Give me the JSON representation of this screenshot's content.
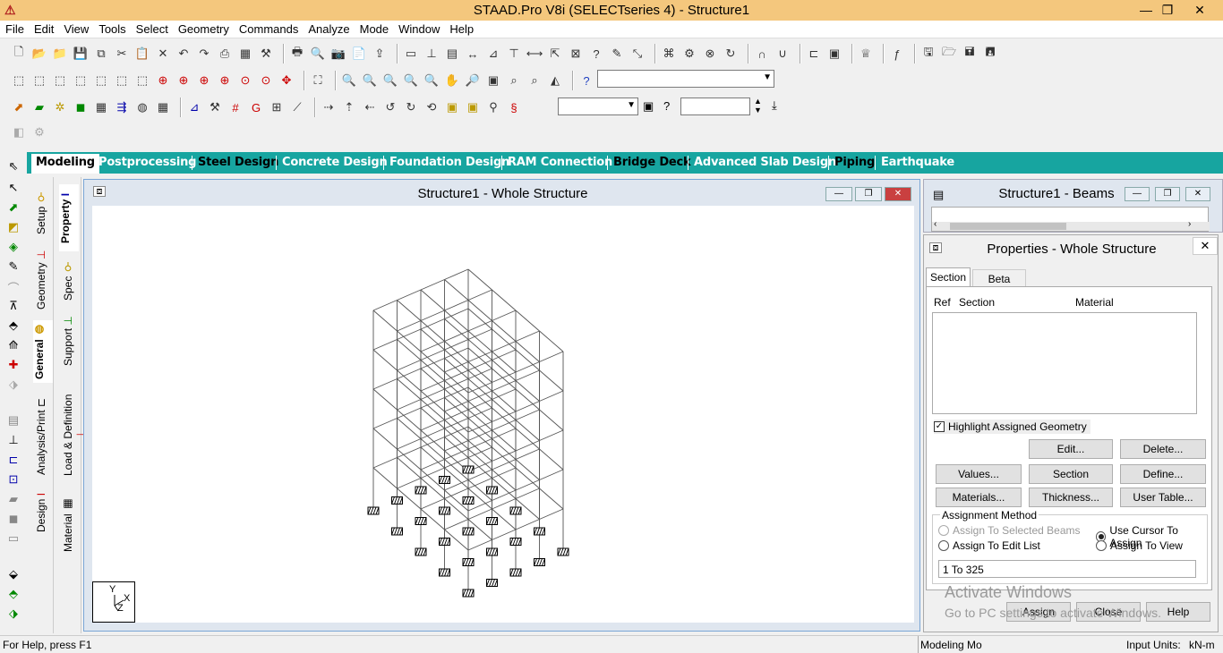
{
  "app": {
    "title": "STAAD.Pro V8i (SELECTseries 4) - Structure1",
    "icon_glyph": "⚠",
    "minimize": "—",
    "restore": "❐",
    "close": "✕"
  },
  "menus": [
    "File",
    "Edit",
    "View",
    "Tools",
    "Select",
    "Geometry",
    "Commands",
    "Analyze",
    "Mode",
    "Window",
    "Help"
  ],
  "toolbar2": {
    "combo_value": ""
  },
  "toolbar3": {
    "combo_value": "",
    "input_value": ""
  },
  "tabs": [
    {
      "label": "Modeling",
      "style": "active"
    },
    {
      "label": "Postprocessing",
      "style": "light"
    },
    {
      "label": "Steel Design",
      "style": "dark"
    },
    {
      "label": "Concrete Design",
      "style": "light"
    },
    {
      "label": "Foundation Design",
      "style": "light"
    },
    {
      "label": "RAM Connection",
      "style": "light"
    },
    {
      "label": "Bridge Deck",
      "style": "dark"
    },
    {
      "label": "Advanced Slab Design",
      "style": "light"
    },
    {
      "label": "Piping",
      "style": "dark"
    },
    {
      "label": "Earthquake",
      "style": "light"
    }
  ],
  "page_control_outer": [
    "Setup",
    "Geometry",
    "General",
    "Analysis/Print",
    "Design"
  ],
  "page_control_inner": [
    "Property",
    "Spec",
    "Support",
    "Load & Definition",
    "Material"
  ],
  "structure_window": {
    "title": "Structure1 - Whole Structure"
  },
  "axis": {
    "y": "Y",
    "x": "X",
    "z": "Z"
  },
  "beams_window": {
    "title": "Structure1 - Beams"
  },
  "properties": {
    "title": "Properties - Whole Structure",
    "tabs": [
      "Section",
      "Beta Angle"
    ],
    "columns": {
      "ref": "Ref",
      "section": "Section",
      "material": "Material"
    },
    "highlight_label": "Highlight Assigned Geometry",
    "buttons": {
      "edit": "Edit...",
      "delete": "Delete...",
      "values": "Values...",
      "section_db": "Section Database",
      "define": "Define...",
      "materials": "Materials...",
      "thickness": "Thickness...",
      "user_table": "User Table..."
    },
    "assignment": {
      "legend": "Assignment Method",
      "selected_beams": "Assign To Selected Beams",
      "cursor": "Use Cursor To Assign",
      "edit_list": "Assign To Edit List",
      "view": "Assign To View",
      "list_value": "1 To 325"
    },
    "footer": {
      "assign": "Assign",
      "close": "Close",
      "help": "Help"
    }
  },
  "watermark": {
    "line1": "Activate Windows",
    "line2": "Go to PC settings to activate Windows."
  },
  "status": {
    "help": "For Help, press F1",
    "mode": "Modeling Mo",
    "units_label": "Input Units:",
    "units_value": "kN-m"
  },
  "colors": {
    "tab_bar": "#17a5a0",
    "title_bar": "#f4c77d"
  }
}
